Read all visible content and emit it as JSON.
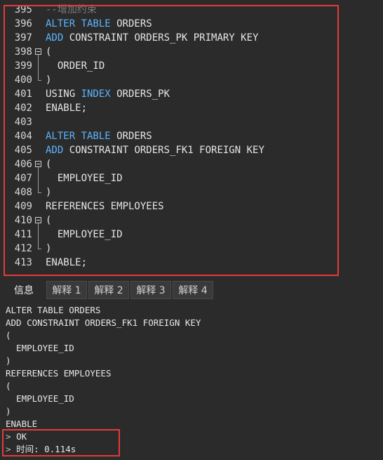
{
  "editor": {
    "lines": [
      {
        "num": "395",
        "segments": [
          {
            "t": "--增加约束",
            "c": "cm"
          }
        ]
      },
      {
        "num": "396",
        "segments": [
          {
            "t": "ALTER TABLE",
            "c": "kw"
          },
          {
            "t": " ORDERS",
            "c": ""
          }
        ]
      },
      {
        "num": "397",
        "segments": [
          {
            "t": "ADD",
            "c": "kw"
          },
          {
            "t": " CONSTRAINT ORDERS_PK PRIMARY KEY",
            "c": ""
          }
        ]
      },
      {
        "num": "398",
        "segments": [
          {
            "t": "(",
            "c": ""
          }
        ],
        "fold": "start"
      },
      {
        "num": "399",
        "segments": [
          {
            "t": "  ORDER_ID",
            "c": ""
          }
        ],
        "fold": "mid"
      },
      {
        "num": "400",
        "segments": [
          {
            "t": ")",
            "c": ""
          }
        ],
        "fold": "end"
      },
      {
        "num": "401",
        "segments": [
          {
            "t": "USING ",
            "c": ""
          },
          {
            "t": "INDEX",
            "c": "kw"
          },
          {
            "t": " ORDERS_PK",
            "c": ""
          }
        ]
      },
      {
        "num": "402",
        "segments": [
          {
            "t": "ENABLE;",
            "c": ""
          }
        ]
      },
      {
        "num": "403",
        "segments": []
      },
      {
        "num": "404",
        "segments": [
          {
            "t": "ALTER TABLE",
            "c": "kw"
          },
          {
            "t": " ORDERS",
            "c": ""
          }
        ]
      },
      {
        "num": "405",
        "segments": [
          {
            "t": "ADD",
            "c": "kw"
          },
          {
            "t": " CONSTRAINT ORDERS_FK1 FOREIGN KEY",
            "c": ""
          }
        ]
      },
      {
        "num": "406",
        "segments": [
          {
            "t": "(",
            "c": ""
          }
        ],
        "fold": "start"
      },
      {
        "num": "407",
        "segments": [
          {
            "t": "  EMPLOYEE_ID",
            "c": ""
          }
        ],
        "fold": "mid"
      },
      {
        "num": "408",
        "segments": [
          {
            "t": ")",
            "c": ""
          }
        ],
        "fold": "end"
      },
      {
        "num": "409",
        "segments": [
          {
            "t": "REFERENCES EMPLOYEES",
            "c": ""
          }
        ]
      },
      {
        "num": "410",
        "segments": [
          {
            "t": "(",
            "c": ""
          }
        ],
        "fold": "start"
      },
      {
        "num": "411",
        "segments": [
          {
            "t": "  EMPLOYEE_ID",
            "c": ""
          }
        ],
        "fold": "mid"
      },
      {
        "num": "412",
        "segments": [
          {
            "t": ")",
            "c": ""
          }
        ],
        "fold": "end"
      },
      {
        "num": "413",
        "segments": [
          {
            "t": "ENABLE;",
            "c": ""
          }
        ]
      }
    ]
  },
  "tabs": [
    {
      "label": "信息",
      "active": true
    },
    {
      "label": "解释 1",
      "active": false
    },
    {
      "label": "解释 2",
      "active": false
    },
    {
      "label": "解释 3",
      "active": false
    },
    {
      "label": "解释 4",
      "active": false
    }
  ],
  "output": {
    "lines": [
      {
        "text": "ALTER TABLE ORDERS",
        "prompt": ""
      },
      {
        "text": "ADD CONSTRAINT ORDERS_FK1 FOREIGN KEY",
        "prompt": ""
      },
      {
        "text": "(",
        "prompt": ""
      },
      {
        "text": "  EMPLOYEE_ID",
        "prompt": ""
      },
      {
        "text": ")",
        "prompt": ""
      },
      {
        "text": "REFERENCES EMPLOYEES",
        "prompt": ""
      },
      {
        "text": "(",
        "prompt": ""
      },
      {
        "text": "  EMPLOYEE_ID",
        "prompt": ""
      },
      {
        "text": ")",
        "prompt": ""
      },
      {
        "text": "ENABLE",
        "prompt": ""
      },
      {
        "text": "OK",
        "prompt": ">"
      },
      {
        "text": "时间: 0.114s",
        "prompt": ">"
      }
    ]
  },
  "colors": {
    "keyword": "#5cb4ff",
    "comment": "#7a7a7a",
    "highlight_box": "#e53a3a",
    "background": "#2b2b2b"
  }
}
